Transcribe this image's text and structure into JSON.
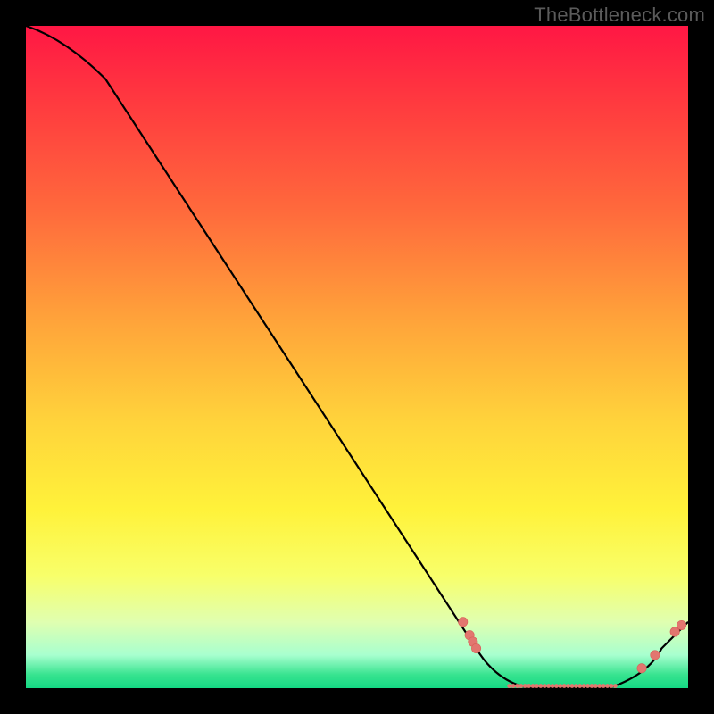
{
  "watermark": "TheBottleneck.com",
  "colors": {
    "marker_fill": "#e2766f",
    "marker_stroke": "#d85f58",
    "line": "#000000"
  },
  "chart_data": {
    "type": "line",
    "title": "",
    "xlabel": "",
    "ylabel": "",
    "xlim": [
      0,
      100
    ],
    "ylim": [
      0,
      100
    ],
    "grid": false,
    "line": {
      "x": [
        0,
        4,
        8,
        12,
        68,
        72,
        76,
        80,
        84,
        88,
        92,
        96,
        100
      ],
      "y": [
        100,
        98,
        96,
        92,
        6,
        2,
        0,
        0,
        0,
        0,
        2,
        6,
        10
      ]
    },
    "markers": [
      {
        "x": 66,
        "y": 10
      },
      {
        "x": 67,
        "y": 8
      },
      {
        "x": 67.5,
        "y": 7
      },
      {
        "x": 68,
        "y": 6
      },
      {
        "x": 93,
        "y": 3
      },
      {
        "x": 95,
        "y": 5
      },
      {
        "x": 98,
        "y": 8.5
      },
      {
        "x": 99,
        "y": 9.5
      }
    ],
    "annotation_small_markers": {
      "x_start": 73,
      "x_end": 89,
      "count": 28,
      "y": 0.2
    }
  }
}
